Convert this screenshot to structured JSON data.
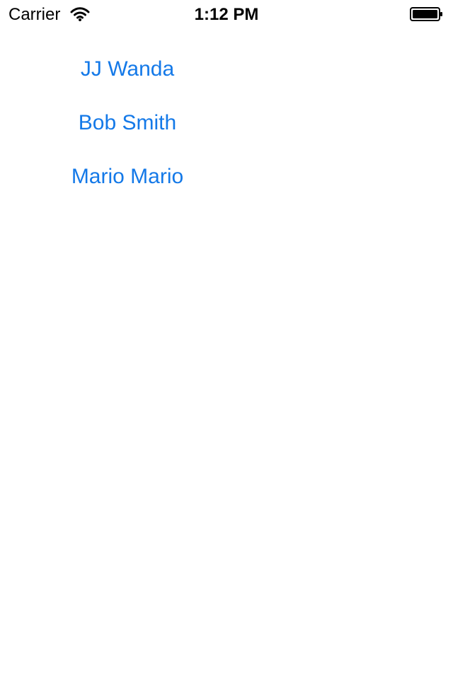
{
  "status_bar": {
    "carrier": "Carrier",
    "time": "1:12 PM",
    "icons": {
      "wifi": "wifi-icon",
      "battery": "battery-icon"
    }
  },
  "contacts": [
    {
      "label": "JJ Wanda"
    },
    {
      "label": "Bob Smith"
    },
    {
      "label": "Mario Mario"
    }
  ],
  "colors": {
    "background": "#ffffff",
    "status_text": "#000000",
    "link": "#1479e8"
  }
}
